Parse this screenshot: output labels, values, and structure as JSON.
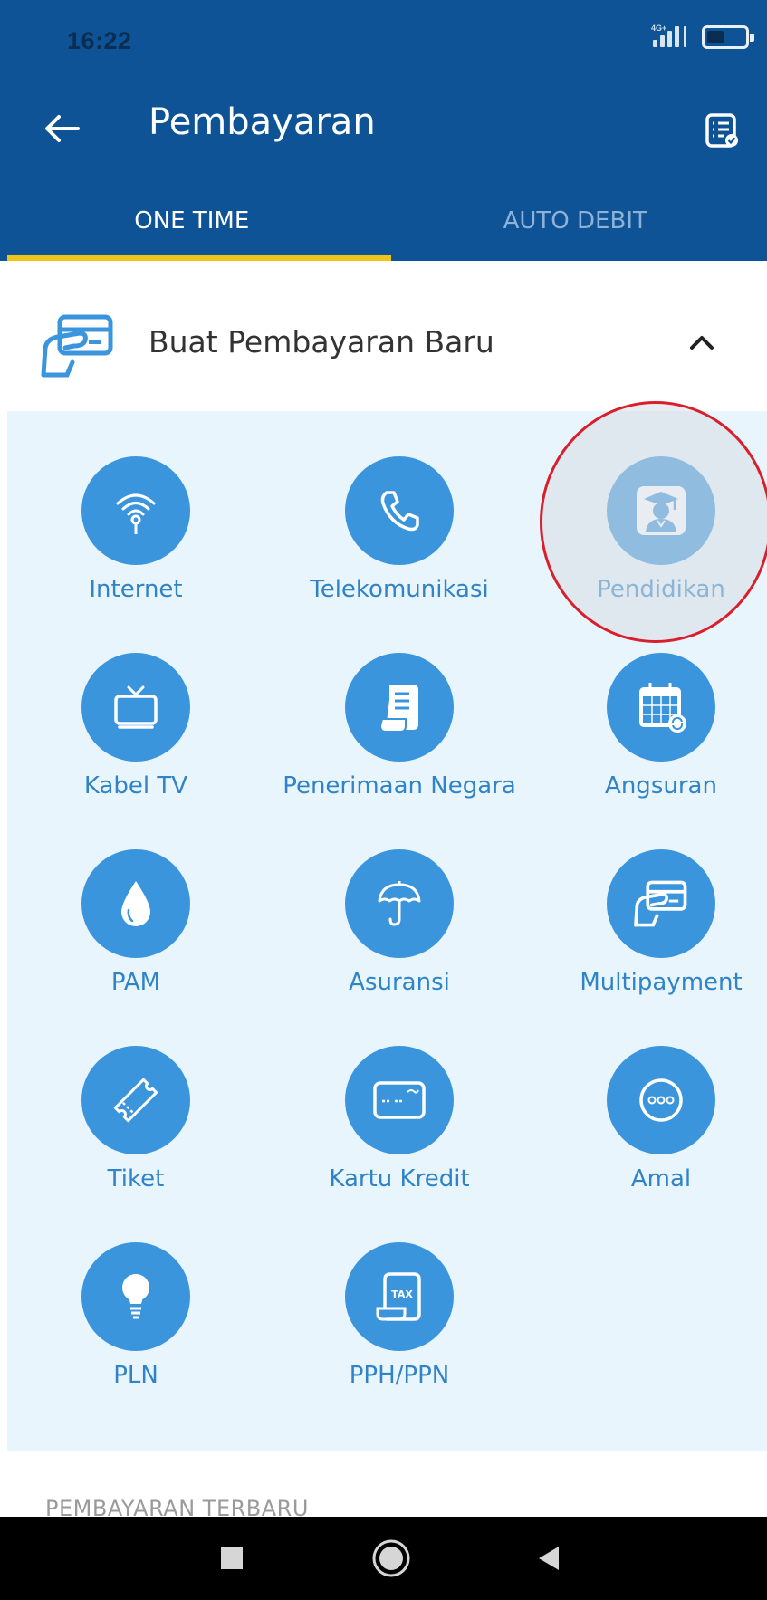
{
  "status_bar": {
    "time": "16:22",
    "network_label": "4G+"
  },
  "app_bar": {
    "title": "Pembayaran",
    "back_icon": "arrow-left-icon",
    "action_icon": "receipt-list-icon"
  },
  "tabs": [
    {
      "label": "ONE TIME",
      "active": true
    },
    {
      "label": "AUTO DEBIT",
      "active": false
    }
  ],
  "section": {
    "title": "Buat Pembayaran Baru",
    "icon": "card-in-hand-icon",
    "toggle_icon": "chevron-up-icon"
  },
  "categories": [
    {
      "label": "Internet",
      "icon": "wifi-icon"
    },
    {
      "label": "Telekomunikasi",
      "icon": "phone-icon"
    },
    {
      "label": "Pendidikan",
      "icon": "graduate-icon",
      "highlighted": true
    },
    {
      "label": "Kabel TV",
      "icon": "tv-icon"
    },
    {
      "label": "Penerimaan Negara",
      "icon": "scroll-document-icon"
    },
    {
      "label": "Angsuran",
      "icon": "calendar-recurring-icon"
    },
    {
      "label": "PAM",
      "icon": "water-drop-icon"
    },
    {
      "label": "Asuransi",
      "icon": "umbrella-icon"
    },
    {
      "label": "Multipayment",
      "icon": "card-in-hand-icon"
    },
    {
      "label": "Tiket",
      "icon": "ticket-icon"
    },
    {
      "label": "Kartu Kredit",
      "icon": "credit-card-icon"
    },
    {
      "label": "Amal",
      "icon": "more-dots-icon"
    },
    {
      "label": "PLN",
      "icon": "light-bulb-icon"
    },
    {
      "label": "PPH/PPN",
      "icon": "tax-document-icon"
    }
  ],
  "recent": {
    "label": "PEMBAYARAN TERBARU"
  },
  "colors": {
    "primary": "#0d5395",
    "accent_indicator": "#f0c419",
    "category_circle": "#3b95dc",
    "panel_background": "#e8f5fc",
    "highlight_ring": "#d91e2c"
  },
  "nav": {
    "recents_icon": "square-icon",
    "home_icon": "circle-home-icon",
    "back_icon": "triangle-back-icon"
  }
}
